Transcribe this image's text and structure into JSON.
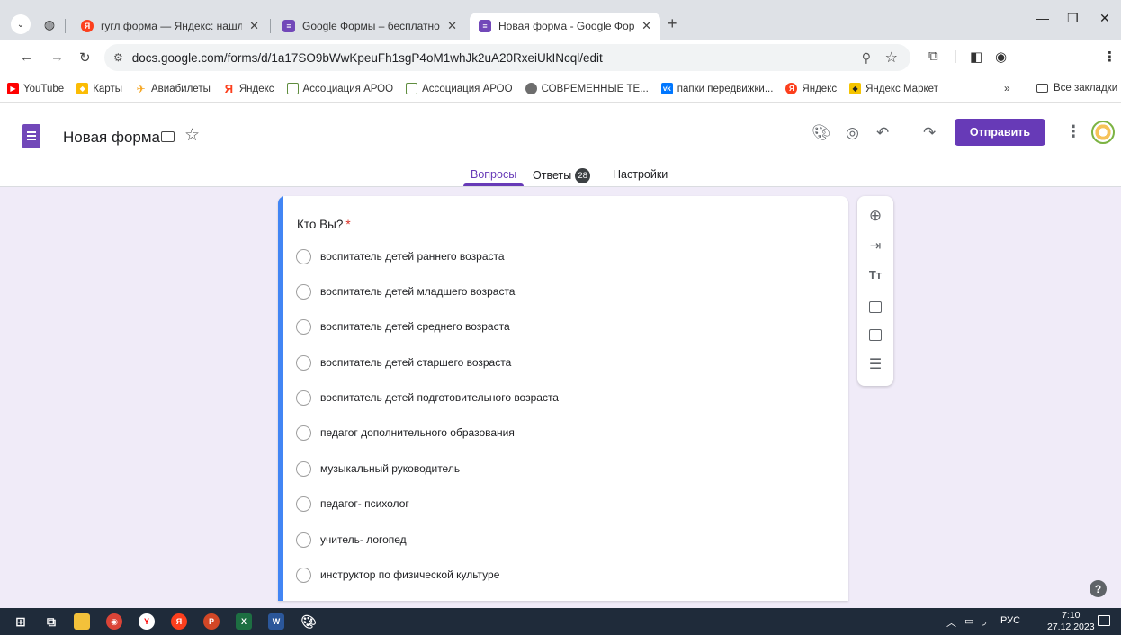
{
  "browser": {
    "tabs": [
      {
        "title": "гугл форма — Яндекс: нашлос",
        "favicon_color": "#fc3f1d",
        "favicon_glyph": "Я"
      },
      {
        "title": "Google Формы – бесплатное с",
        "favicon_color": "#7248b9",
        "favicon_glyph": "≡"
      },
      {
        "title": "Новая форма - Google Формы",
        "favicon_color": "#7248b9",
        "favicon_glyph": "≡",
        "active": true
      }
    ],
    "url": "docs.google.com/forms/d/1a17SO9bWwKpeuFh1sgP4oM1whJk2uA20RxeiUkINcql/edit",
    "bookmarks": [
      {
        "label": "YouTube",
        "icon": "youtube-icon",
        "color": "#ff0000"
      },
      {
        "label": "Карты",
        "icon": "maps-icon",
        "color": "#fbbc04"
      },
      {
        "label": "Авиабилеты",
        "icon": "plane-icon",
        "color": "#f5a623"
      },
      {
        "label": "Яндекс",
        "icon": "yandex-icon",
        "color": "#fc3f1d"
      },
      {
        "label": "Ассоциация АРОО",
        "icon": "site-icon",
        "color": "#5f8d3e"
      },
      {
        "label": "Ассоциация АРОО",
        "icon": "site-icon",
        "color": "#5f8d3e"
      },
      {
        "label": "СОВРЕМЕННЫЕ ТЕ...",
        "icon": "site-icon",
        "color": "#6d6d6d"
      },
      {
        "label": "папки передвижки...",
        "icon": "vk-icon",
        "color": "#0077ff"
      },
      {
        "label": "Яндекс",
        "icon": "yandex-icon",
        "color": "#fc3f1d"
      },
      {
        "label": "Яндекс Маркет",
        "icon": "market-icon",
        "color": "#f5c400"
      }
    ],
    "bookmarks_more": "»",
    "all_bookmarks": "Все закладки"
  },
  "header": {
    "form_title": "Новая форма",
    "send_label": "Отправить",
    "tabs": [
      {
        "label": "Вопросы",
        "active": true
      },
      {
        "label": "Ответы",
        "badge": "28"
      },
      {
        "label": "Настройки"
      }
    ]
  },
  "question": {
    "title": "Кто Вы?",
    "required_mark": "*",
    "options": [
      "воспитатель детей раннего возраста",
      "воспитатель детей  младшего возраста",
      "воспитатель детей среднего возраста",
      "воспитатель детей  старшего возраста",
      "воспитатель детей  подготовительного возраста",
      "педагог дополнительного образования",
      "музыкальный руководитель",
      "педагог- психолог",
      "учитель- логопед",
      "инструктор по физической культуре"
    ]
  },
  "taskbar": {
    "language": "РУС",
    "time": "7:10",
    "date": "27.12.2023"
  },
  "colors": {
    "accent": "#673ab7",
    "card_accent": "#4285f4",
    "background": "#f0ebf8",
    "required": "#d93025"
  }
}
